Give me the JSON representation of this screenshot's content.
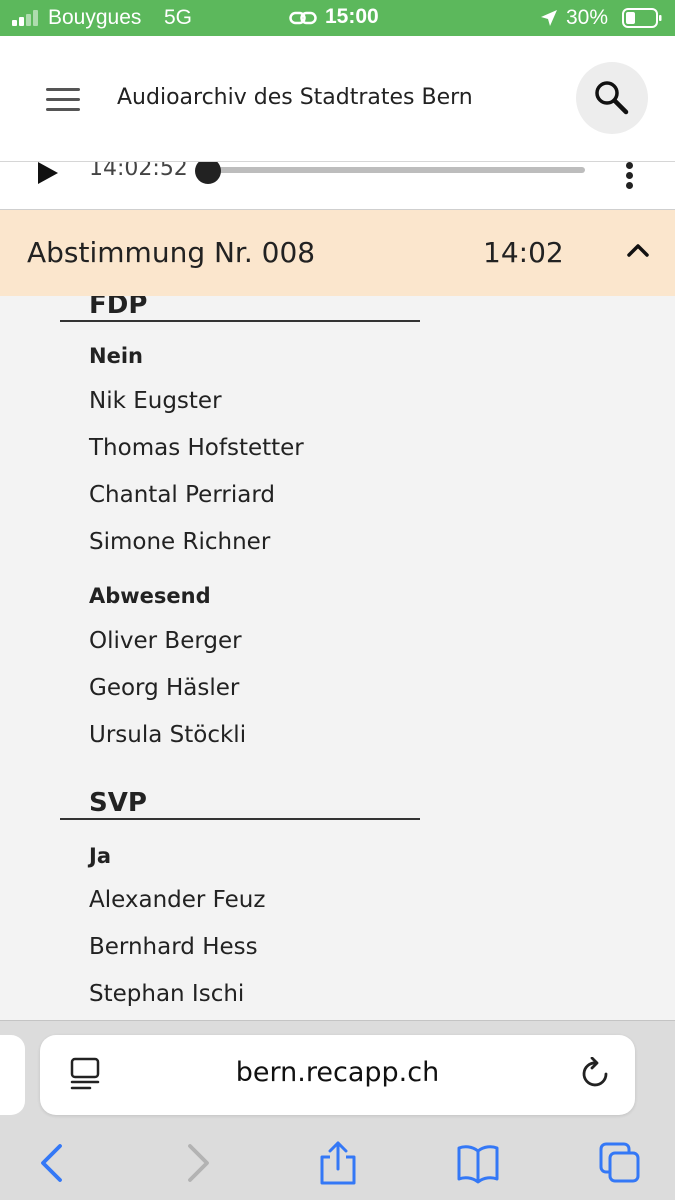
{
  "status": {
    "carrier": "Bouygues",
    "network": "5G",
    "time": "15:00",
    "battery": "30%"
  },
  "header": {
    "title": "Audioarchiv des Stadtrates Bern"
  },
  "player": {
    "time": "14:02:52",
    "progress": 0
  },
  "vote": {
    "title": "Abstimmung Nr. 008",
    "time": "14:02"
  },
  "parties": [
    {
      "name": "FDP",
      "groups": [
        {
          "label": "Nein",
          "members": [
            "Nik Eugster",
            "Thomas Hofstetter",
            "Chantal Perriard",
            "Simone Richner"
          ]
        },
        {
          "label": "Abwesend",
          "members": [
            "Oliver Berger",
            "Georg Häsler",
            "Ursula Stöckli"
          ]
        }
      ]
    },
    {
      "name": "SVP",
      "groups": [
        {
          "label": "Ja",
          "members": [
            "Alexander Feuz",
            "Bernhard Hess",
            "Stephan Ischi"
          ]
        }
      ]
    }
  ],
  "browser": {
    "url": "bern.recapp.ch"
  },
  "colors": {
    "status_bar": "#5cb85c",
    "vote_header": "#fbe6cd",
    "toolbar_accent": "#3478f6"
  },
  "icons": [
    "link-icon",
    "location-arrow-icon",
    "battery-icon",
    "hamburger-icon",
    "search-icon",
    "play-icon",
    "more-vertical-icon",
    "chevron-up-icon",
    "reader-icon",
    "reload-icon",
    "back-icon",
    "forward-icon",
    "share-icon",
    "bookmarks-icon",
    "tabs-icon"
  ]
}
